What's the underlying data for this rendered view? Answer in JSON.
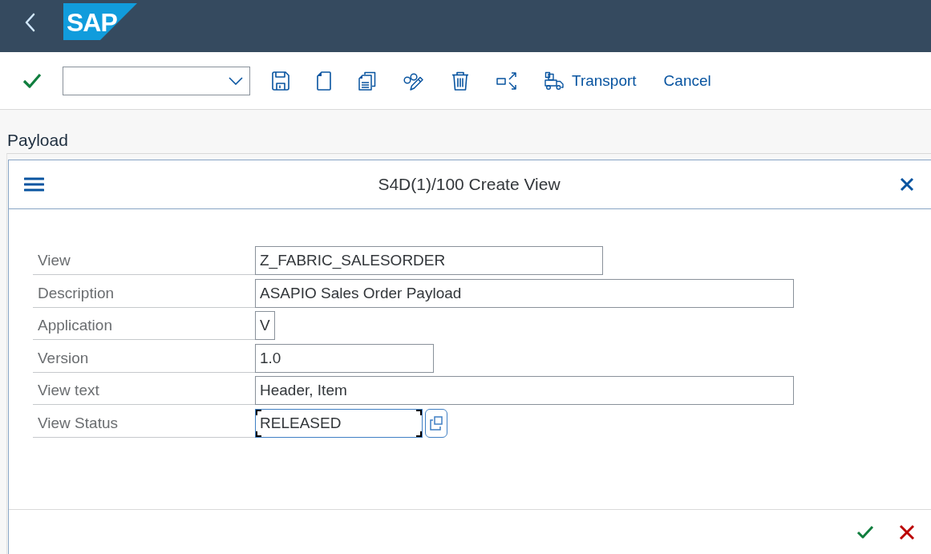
{
  "shell_bar": {
    "logo": "SAP"
  },
  "toolbar": {
    "buttons": [
      {
        "label": "Transport",
        "kind": "icon_text"
      },
      {
        "label": "Cancel",
        "kind": "text"
      }
    ]
  },
  "page": {
    "title": "Payload"
  },
  "dialog": {
    "title": "S4D(1)/100 Create View",
    "fields": [
      {
        "label": "View",
        "value": "Z_FABRIC_SALESORDER",
        "focused": false,
        "value_help": false
      },
      {
        "label": "Description",
        "value": "ASAPIO Sales Order Payload",
        "focused": false,
        "value_help": false
      },
      {
        "label": "Application",
        "value": "V",
        "focused": false,
        "value_help": false
      },
      {
        "label": "Version",
        "value": "1.0",
        "focused": false,
        "value_help": false
      },
      {
        "label": "View text",
        "value": "Header, Item",
        "focused": false,
        "value_help": false
      },
      {
        "label": "View Status",
        "value": "RELEASED",
        "focused": true,
        "value_help": true
      }
    ]
  }
}
